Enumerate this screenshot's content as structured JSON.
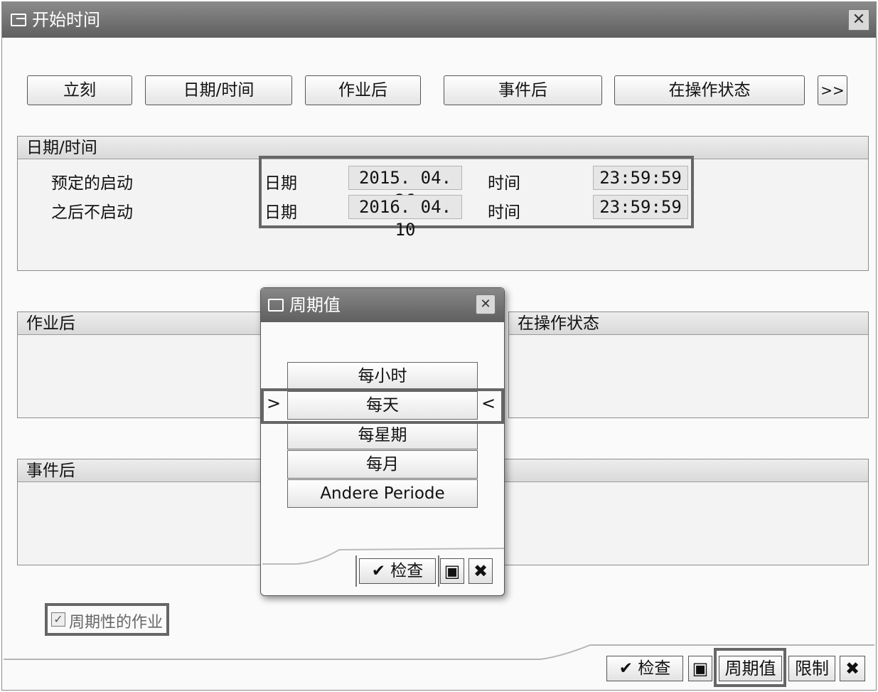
{
  "window": {
    "title": "开始时间",
    "close_label": "✕"
  },
  "toolbar": {
    "buttons": [
      {
        "label": "立刻"
      },
      {
        "label": "日期/时间"
      },
      {
        "label": "作业后"
      },
      {
        "label": "事件后"
      },
      {
        "label": "在操作状态"
      }
    ],
    "more_label": ">>"
  },
  "datetime_group": {
    "header": "日期/时间",
    "rows": [
      {
        "label": "预定的启动",
        "date_label": "日期",
        "date_value": "2015. 04. 26",
        "time_label": "时间",
        "time_value": "23:59:59"
      },
      {
        "label": "之后不启动",
        "date_label": "日期",
        "date_value": "2016. 04. 10",
        "time_label": "时间",
        "time_value": "23:59:59"
      }
    ]
  },
  "after_job_group": {
    "header": "作业后"
  },
  "op_state_group": {
    "header": "在操作状态"
  },
  "after_event_group": {
    "header": "事件后"
  },
  "periodic_checkbox": {
    "label": "周期性的作业",
    "checked": true
  },
  "bottom_bar": {
    "check_label": "检查",
    "period_label": "周期值",
    "restrict_label": "限制"
  },
  "period_popup": {
    "title": "周期值",
    "close_label": "✕",
    "options": [
      {
        "label": "每小时"
      },
      {
        "label": "每天"
      },
      {
        "label": "每星期"
      },
      {
        "label": "每月"
      },
      {
        "label": "Andere Periode"
      }
    ],
    "selected_marker_left": ">",
    "selected_marker_right": "<",
    "check_label": "检查"
  }
}
